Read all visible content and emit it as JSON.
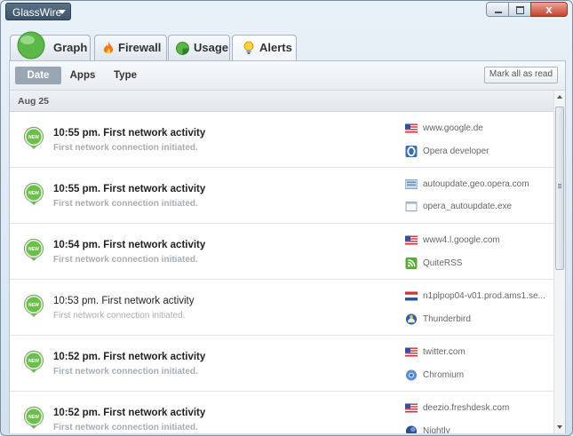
{
  "app": {
    "menu_label": "GlassWire"
  },
  "window": {
    "close_glyph": "x"
  },
  "tabs": [
    {
      "label": "Graph",
      "icon": "graph-globe-icon"
    },
    {
      "label": "Firewall",
      "icon": "firewall-flame-icon"
    },
    {
      "label": "Usage",
      "icon": "usage-pie-icon"
    },
    {
      "label": "Alerts",
      "icon": "alerts-bulb-icon",
      "active": true
    }
  ],
  "subtabs": [
    {
      "label": "Date",
      "active": true
    },
    {
      "label": "Apps"
    },
    {
      "label": "Type"
    }
  ],
  "mark_all_label": "Mark all as read",
  "date_header": "Aug 25",
  "badge_label": "NEW",
  "alerts": [
    {
      "title": "10:55 pm. First network activity",
      "subtitle": "First network connection initiated.",
      "host": "www.google.de",
      "host_icon": "us-flag-icon",
      "app": "Opera developer",
      "app_icon": "opera-icon",
      "unread": true
    },
    {
      "title": "10:55 pm. First network activity",
      "subtitle": "First network connection initiated.",
      "host": "autoupdate.geo.opera.com",
      "host_icon": "network-icon",
      "app": "opera_autoupdate.exe",
      "app_icon": "exe-window-icon",
      "unread": true
    },
    {
      "title": "10:54 pm. First network activity",
      "subtitle": "First network connection initiated.",
      "host": "www4.l.google.com",
      "host_icon": "us-flag-icon",
      "app": "QuiteRSS",
      "app_icon": "rss-icon",
      "unread": true
    },
    {
      "title": "10:53 pm. First network activity",
      "subtitle": "First network connection initiated.",
      "host": "n1plpop04-v01.prod.ams1.se...",
      "host_icon": "nl-flag-icon",
      "app": "Thunderbird",
      "app_icon": "thunderbird-icon",
      "unread": false
    },
    {
      "title": "10:52 pm. First network activity",
      "subtitle": "First network connection initiated.",
      "host": "twitter.com",
      "host_icon": "us-flag-icon",
      "app": "Chromium",
      "app_icon": "chromium-icon",
      "unread": true
    },
    {
      "title": "10:52 pm. First network activity",
      "subtitle": "First network connection initiated.",
      "host": "deezio.freshdesk.com",
      "host_icon": "us-flag-icon",
      "app": "Nightly",
      "app_icon": "nightly-icon",
      "unread": true
    }
  ],
  "colors": {
    "badge_green": "#6cc04a",
    "accent_blue": "#3d5468",
    "link_gray": "#666666"
  }
}
